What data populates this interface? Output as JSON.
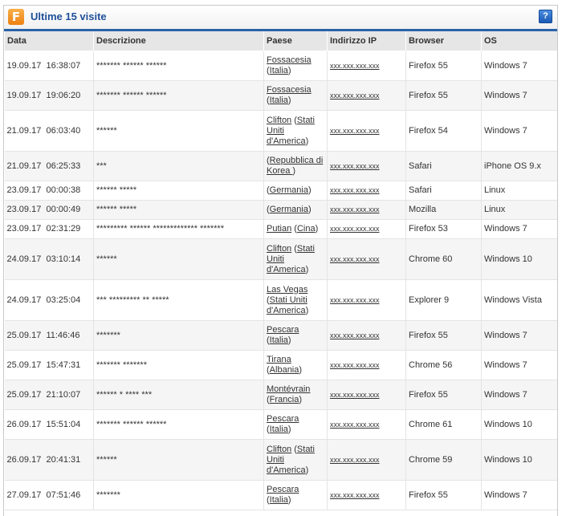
{
  "panel": {
    "title": "Ultime 15 visite",
    "logo_letter": "F",
    "help_label": "?"
  },
  "columns": [
    "Data",
    "Descrizione",
    "Paese",
    "Indirizzo IP",
    "Browser",
    "OS"
  ],
  "rows": [
    {
      "date": "19.09.17",
      "time": "16:38:07",
      "desc": "******* ****** ******",
      "city": "Fossacesia",
      "country": "Italia",
      "ip": "xxx.xxx.xxx.xxx",
      "browser": "Firefox 55",
      "os": "Windows 7"
    },
    {
      "date": "19.09.17",
      "time": "19:06:20",
      "desc": "******* ****** ******",
      "city": "Fossacesia",
      "country": "Italia",
      "ip": "xxx.xxx.xxx.xxx",
      "browser": "Firefox 55",
      "os": "Windows 7"
    },
    {
      "date": "21.09.17",
      "time": "06:03:40",
      "desc": "******",
      "city": "Clifton",
      "country": "Stati Uniti d'America",
      "ip": "xxx.xxx.xxx.xxx",
      "browser": "Firefox 54",
      "os": "Windows 7"
    },
    {
      "date": "21.09.17",
      "time": "06:25:33",
      "desc": "***",
      "city": "",
      "country": "Repubblica di Korea ",
      "ip": "xxx.xxx.xxx.xxx",
      "browser": "Safari",
      "os": "iPhone OS 9.x"
    },
    {
      "date": "23.09.17",
      "time": "00:00:38",
      "desc": "****** *****",
      "city": "",
      "country": "Germania",
      "ip": "xxx.xxx.xxx.xxx",
      "browser": "Safari",
      "os": "Linux"
    },
    {
      "date": "23.09.17",
      "time": "00:00:49",
      "desc": "****** *****",
      "city": "",
      "country": "Germania",
      "ip": "xxx.xxx.xxx.xxx",
      "browser": "Mozilla",
      "os": "Linux"
    },
    {
      "date": "23.09.17",
      "time": "02:31:29",
      "desc": "********* ****** ************* *******",
      "city": "Putian",
      "country": "Cina",
      "ip": "xxx.xxx.xxx.xxx",
      "browser": "Firefox 53",
      "os": "Windows 7"
    },
    {
      "date": "24.09.17",
      "time": "03:10:14",
      "desc": "******",
      "city": "Clifton",
      "country": "Stati Uniti d'America",
      "ip": "xxx.xxx.xxx.xxx",
      "browser": "Chrome 60",
      "os": "Windows 10"
    },
    {
      "date": "24.09.17",
      "time": "03:25:04",
      "desc": "*** ********* ** *****",
      "city": "Las Vegas",
      "country": "Stati Uniti d'America",
      "ip": "xxx.xxx.xxx.xxx",
      "browser": "Explorer 9",
      "os": "Windows Vista"
    },
    {
      "date": "25.09.17",
      "time": "11:46:46",
      "desc": "*******",
      "city": "Pescara",
      "country": "Italia",
      "ip": "xxx.xxx.xxx.xxx",
      "browser": "Firefox 55",
      "os": "Windows 7"
    },
    {
      "date": "25.09.17",
      "time": "15:47:31",
      "desc": "******* *******",
      "city": "Tirana",
      "country": "Albania",
      "ip": "xxx.xxx.xxx.xxx",
      "browser": "Chrome 56",
      "os": "Windows 7"
    },
    {
      "date": "25.09.17",
      "time": "21:10:07",
      "desc": "****** * **** ***",
      "city": "Montévrain",
      "country": "Francia",
      "ip": "xxx.xxx.xxx.xxx",
      "browser": "Firefox 55",
      "os": "Windows 7"
    },
    {
      "date": "26.09.17",
      "time": "15:51:04",
      "desc": "******* ****** ******",
      "city": "Pescara",
      "country": "Italia",
      "ip": "xxx.xxx.xxx.xxx",
      "browser": "Chrome 61",
      "os": "Windows 10"
    },
    {
      "date": "26.09.17",
      "time": "20:41:31",
      "desc": "******",
      "city": "Clifton",
      "country": "Stati Uniti d'America",
      "ip": "xxx.xxx.xxx.xxx",
      "browser": "Chrome 59",
      "os": "Windows 10"
    },
    {
      "date": "27.09.17",
      "time": "07:51:46",
      "desc": "*******",
      "city": "Pescara",
      "country": "Italia",
      "ip": "xxx.xxx.xxx.xxx",
      "browser": "Firefox 55",
      "os": "Windows 7"
    }
  ],
  "colors": {
    "title": "#1f4f99",
    "header_rule": "#2b62a8",
    "logo": "#ee7f10",
    "help_button": "#1a58b3"
  }
}
